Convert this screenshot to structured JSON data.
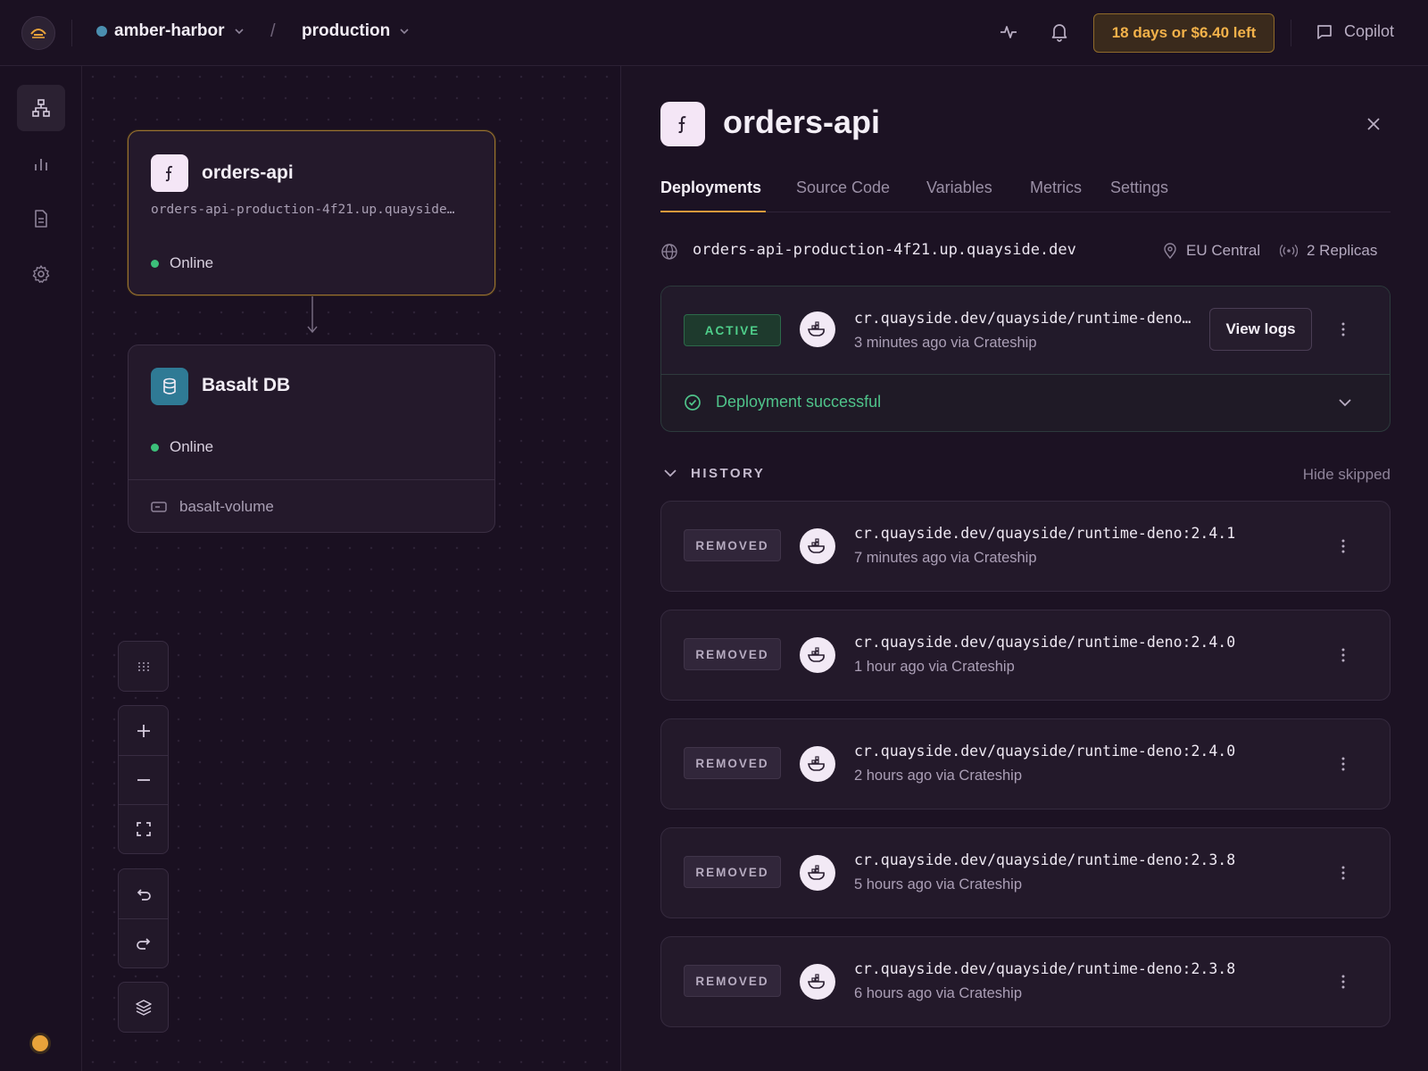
{
  "topbar": {
    "project": "amber-harbor",
    "separator": "/",
    "environment": "production",
    "trial": "18 days or $6.40 left",
    "copilot": "Copilot"
  },
  "canvas": {
    "nodes": [
      {
        "title": "orders-api",
        "url": "orders-api-production-4f21.up.quayside…",
        "status": "Online"
      },
      {
        "title": "Basalt DB",
        "status": "Online",
        "volume": "basalt-volume"
      }
    ]
  },
  "panel": {
    "title": "orders-api",
    "tabs": [
      "Deployments",
      "Source Code",
      "Variables",
      "Metrics",
      "Settings"
    ],
    "url": "orders-api-production-4f21.up.quayside.dev",
    "region": "EU Central",
    "replicas": "2 Replicas",
    "active": {
      "badge": "ACTIVE",
      "image": "cr.quayside.dev/quayside/runtime-deno…",
      "when": "3 minutes ago via Crateship",
      "view_logs": "View logs",
      "status": "Deployment successful"
    },
    "history": {
      "label": "HISTORY",
      "hide_skipped": "Hide skipped",
      "items": [
        {
          "badge": "REMOVED",
          "image": "cr.quayside.dev/quayside/runtime-deno:2.4.1",
          "when": "7 minutes ago via Crateship"
        },
        {
          "badge": "REMOVED",
          "image": "cr.quayside.dev/quayside/runtime-deno:2.4.0",
          "when": "1 hour ago via Crateship"
        },
        {
          "badge": "REMOVED",
          "image": "cr.quayside.dev/quayside/runtime-deno:2.4.0",
          "when": "2 hours ago via Crateship"
        },
        {
          "badge": "REMOVED",
          "image": "cr.quayside.dev/quayside/runtime-deno:2.3.8",
          "when": "5 hours ago via Crateship"
        },
        {
          "badge": "REMOVED",
          "image": "cr.quayside.dev/quayside/runtime-deno:2.3.8",
          "when": "6 hours ago via Crateship"
        }
      ]
    }
  },
  "colors": {
    "background": "#1a1021",
    "accent": "#d99a3c",
    "online": "#3cc07a",
    "db_icon": "#2f7a95"
  }
}
